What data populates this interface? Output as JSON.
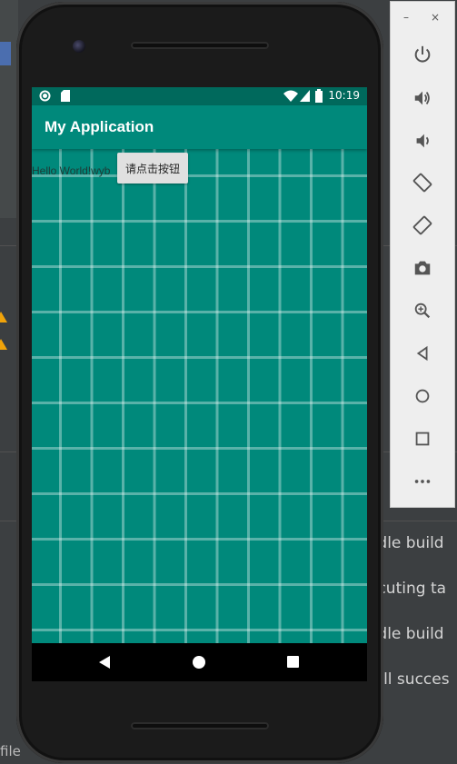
{
  "ide": {
    "file_label": "file",
    "console_lines": [
      "adle build",
      "ecuting ta",
      "adle build",
      "tall succes"
    ]
  },
  "emulator": {
    "status_time": "10:19",
    "app_title": "My Application",
    "hello_text": "Hello World!wyb",
    "button_label": "请点击按钮",
    "colors": {
      "app_bar": "#00897b",
      "status_bar": "#00695c"
    }
  },
  "panel": {
    "minimize": "–",
    "close": "×",
    "tools": [
      "power-icon",
      "volume-up-icon",
      "volume-down-icon",
      "rotate-left-icon",
      "rotate-right-icon",
      "camera-icon",
      "zoom-icon",
      "back-icon",
      "home-icon",
      "overview-icon",
      "more-icon"
    ]
  }
}
